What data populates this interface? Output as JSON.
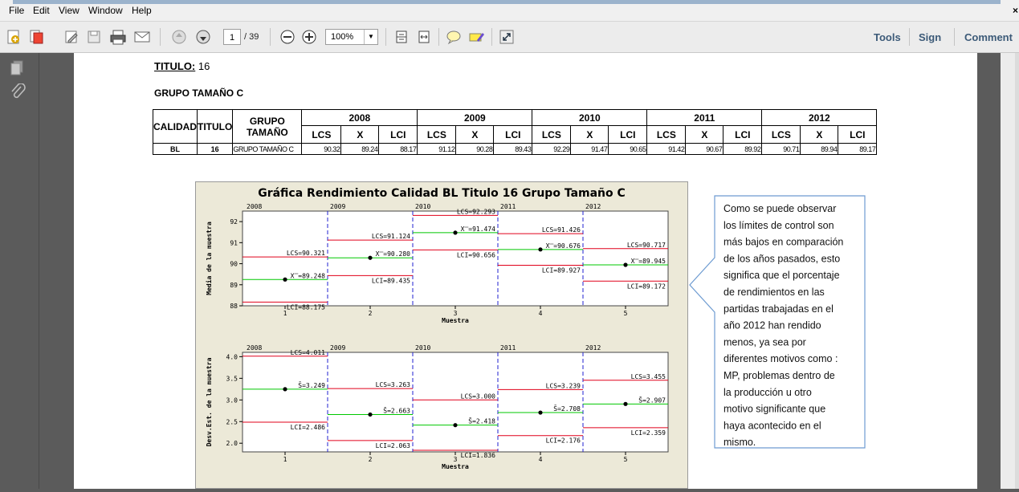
{
  "menu": [
    "File",
    "Edit",
    "View",
    "Window",
    "Help"
  ],
  "menu_close": "×",
  "toolbar": {
    "page_current": "1",
    "page_total": "/ 39",
    "zoom": "100%",
    "tools": "Tools",
    "sign": "Sign",
    "comment": "Comment"
  },
  "doc": {
    "titulo_label": "TITULO:",
    "titulo_value": "16",
    "grupo_heading": "GRUPO TAMAÑO C"
  },
  "table": {
    "h_calidad": "CALIDAD",
    "h_titulo": "TITULO",
    "h_grupo": "GRUPO TAMAÑO",
    "years": [
      "2008",
      "2009",
      "2010",
      "2011",
      "2012"
    ],
    "sub": [
      "LCS",
      "X",
      "LCI"
    ],
    "row": {
      "calidad": "BL",
      "titulo": "16",
      "grupo": "GRUPO TAMAÑO C",
      "values": [
        "90.32",
        "89.24",
        "88.17",
        "91.12",
        "90.28",
        "89.43",
        "92.29",
        "91.47",
        "90.65",
        "91.42",
        "90.67",
        "89.92",
        "90.71",
        "89.94",
        "89.17"
      ]
    }
  },
  "chart_data": {
    "type": "line",
    "title": "Gráfica Rendimiento Calidad BL Titulo 16 Grupo Tamaño C",
    "stages": [
      "2008",
      "2009",
      "2010",
      "2011",
      "2012"
    ],
    "xlabel": "Muestra",
    "x_ticks": [
      "1",
      "2",
      "3",
      "4",
      "5"
    ],
    "mean_chart": {
      "ylabel": "Media de la muestra",
      "ylim": [
        88,
        92.5
      ],
      "y_ticks": [
        "88",
        "89",
        "90",
        "91",
        "92"
      ],
      "points": [
        89.248,
        90.28,
        91.474,
        90.676,
        89.945
      ],
      "lcs": [
        90.321,
        91.124,
        92.293,
        91.426,
        90.717
      ],
      "center": [
        89.248,
        90.28,
        91.474,
        90.676,
        89.945
      ],
      "lci": [
        88.175,
        89.435,
        90.656,
        89.927,
        89.172
      ],
      "lcs_labels": [
        "LCS=90.321",
        "LCS=91.124",
        "LCS=92.293",
        "LCS=91.426",
        "LCS=90.717"
      ],
      "center_labels": [
        "X̿=89.248",
        "X̿=90.280",
        "X̿=91.474",
        "X̿=90.676",
        "X̿=89.945"
      ],
      "lci_labels": [
        "LCI=88.175",
        "LCI=89.435",
        "LCI=90.656",
        "LCI=89.927",
        "LCI=89.172"
      ]
    },
    "sd_chart": {
      "ylabel": "Desv.Est. de la muestra",
      "ylim": [
        1.8,
        4.1
      ],
      "y_ticks": [
        "2.0",
        "2.5",
        "3.0",
        "3.5",
        "4.0"
      ],
      "points": [
        3.249,
        2.663,
        2.418,
        2.708,
        2.907
      ],
      "lcs": [
        4.011,
        3.263,
        3.0,
        3.239,
        3.455
      ],
      "center": [
        3.249,
        2.663,
        2.418,
        2.708,
        2.907
      ],
      "lci": [
        2.486,
        2.063,
        1.836,
        2.176,
        2.359
      ],
      "lcs_labels": [
        "LCS=4.011",
        "LCS=3.263",
        "LCS=3.000",
        "LCS=3.239",
        "LCS=3.455"
      ],
      "center_labels": [
        "S̄=3.249",
        "S̄=2.663",
        "S̄=2.418",
        "S̄=2.708",
        "S̄=2.907"
      ],
      "lci_labels": [
        "LCI=2.486",
        "LCI=2.063",
        "LCI=1.836",
        "LCI=2.176",
        "LCI=2.359"
      ]
    }
  },
  "callout": {
    "lines": [
      "Como se puede observar",
      "los límites de control son",
      "más bajos en comparación",
      "de los años pasados, esto",
      "significa que el porcentaje",
      "de rendimientos en las",
      "partidas trabajadas en el",
      "año 2012 han rendido",
      "menos, ya sea por",
      "diferentes motivos como :",
      "MP, problemas dentro de",
      "la producción u otro",
      "motivo significante que",
      "haya acontecido en el",
      "mismo."
    ]
  },
  "colors": {
    "limit_line": "#e0001a",
    "center_line": "#00c800",
    "stage_divider": "#2020d0",
    "chart_bg": "#ece9d8",
    "callout_border": "#6d9bd1"
  }
}
